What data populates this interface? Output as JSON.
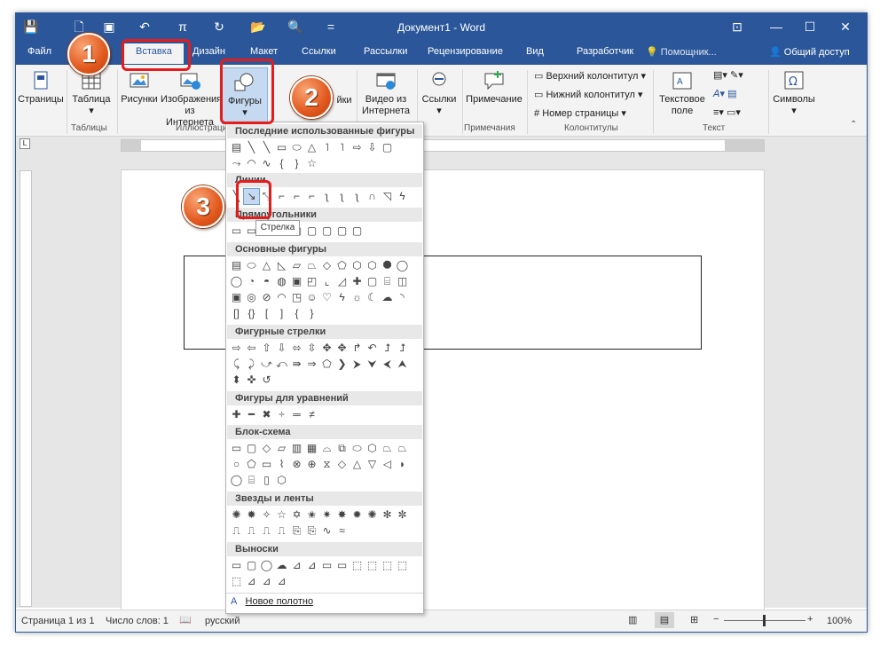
{
  "title": "Документ1 - Word",
  "quick_access": {
    "save": "💾",
    "undo": "↶",
    "pi": "π",
    "redo": "↻",
    "open": "📂",
    "print": "🔍",
    "customize": "="
  },
  "tabs": [
    {
      "label": "Файл"
    },
    {
      "label": "Вставка",
      "active": true
    },
    {
      "label": "Дизайн"
    },
    {
      "label": "Макет"
    },
    {
      "label": "Ссылки"
    },
    {
      "label": "Рассылки"
    },
    {
      "label": "Рецензирование"
    },
    {
      "label": "Вид"
    },
    {
      "label": "Разработчик"
    },
    {
      "label": "Помощник..."
    },
    {
      "label": "Общий доступ"
    }
  ],
  "ribbon": {
    "pages": "Страницы",
    "table": "Таблица",
    "pictures": "Рисунки",
    "online_pictures": "Изображения из Интернета",
    "shapes": "Фигуры",
    "addins": "йки",
    "video": "Видео из Интернета",
    "links": "Ссылки",
    "comment": "Примечание",
    "header": "Верхний колонтитул",
    "footer": "Нижний колонтитул",
    "page_number": "Номер страницы",
    "textbox": "Текстовое поле",
    "symbols": "Символы",
    "groups": {
      "tables": "Таблицы",
      "illustrations": "Иллюстраци",
      "comments": "Примечания",
      "headerfooter": "Колонтитулы",
      "text": "Текст"
    }
  },
  "dropdown": {
    "sections": [
      {
        "title": "Последние использованные фигуры"
      },
      {
        "title": "Линии"
      },
      {
        "title": "Прямоугольники"
      },
      {
        "title": "Основные фигуры"
      },
      {
        "title": "Фигурные стрелки"
      },
      {
        "title": "Фигуры для уравнений"
      },
      {
        "title": "Блок-схема"
      },
      {
        "title": "Звезды и ленты"
      },
      {
        "title": "Выноски"
      }
    ],
    "new_canvas": "Новое полотно",
    "tooltip": "Стрелка"
  },
  "status": {
    "page": "Страница 1 из 1",
    "words": "Число слов: 1",
    "language": "русский",
    "zoom": "100%"
  },
  "badges": [
    "1",
    "2",
    "3"
  ],
  "colors": {
    "accent": "#2b579a",
    "callout": "#e41c1c",
    "badge": "#e2581d"
  }
}
